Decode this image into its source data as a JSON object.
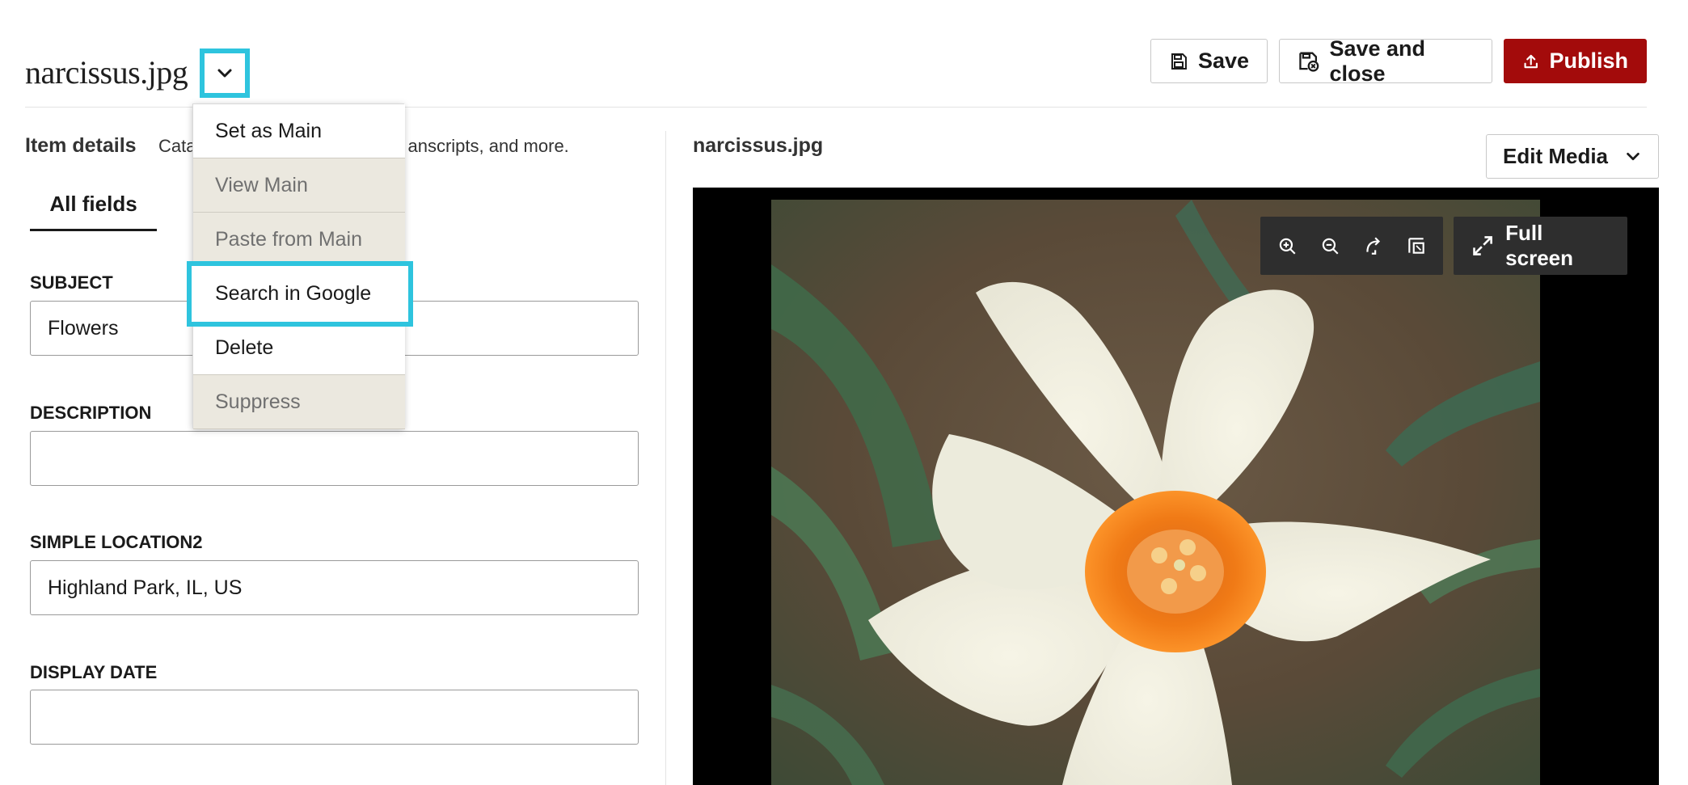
{
  "header": {
    "title": "narcissus.jpg",
    "save_label": "Save",
    "save_close_label": "Save and close",
    "publish_label": "Publish",
    "publish_color": "#a30b0b",
    "highlight_color": "#2ec4de"
  },
  "menu": {
    "items": [
      {
        "label": "Set as Main",
        "enabled": true
      },
      {
        "label": "View Main",
        "enabled": false
      },
      {
        "label": "Paste from Main",
        "enabled": false
      },
      {
        "label": "Search in Google",
        "enabled": true,
        "highlighted": true
      },
      {
        "label": "Delete",
        "enabled": true
      },
      {
        "label": "Suppress",
        "enabled": false
      }
    ]
  },
  "details": {
    "label": "Item details",
    "description_visible": "Cata",
    "description_tail": "anscripts, and more.",
    "tab": "All fields"
  },
  "fields": [
    {
      "label": "SUBJECT",
      "value": "Flowers"
    },
    {
      "label": "DESCRIPTION",
      "value": ""
    },
    {
      "label": "SIMPLE LOCATION2",
      "value": "Highland Park, IL, US"
    },
    {
      "label": "DISPLAY DATE",
      "value": ""
    }
  ],
  "media": {
    "filename": "narcissus.jpg",
    "edit_label": "Edit Media",
    "fullscreen_label": "Full screen",
    "tools": [
      "zoom-in-icon",
      "zoom-out-icon",
      "rotate-icon",
      "fit-icon"
    ]
  }
}
